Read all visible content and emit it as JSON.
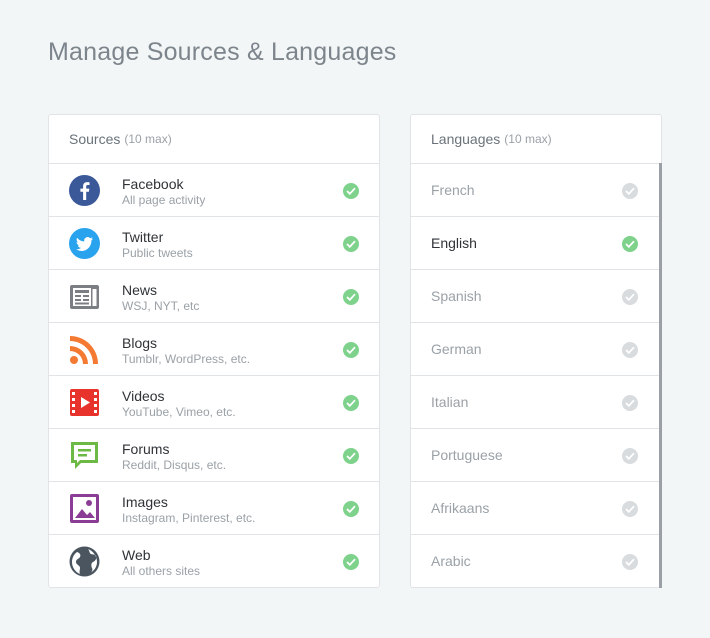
{
  "page": {
    "title": "Manage Sources & Languages"
  },
  "sources": {
    "header": "Sources",
    "max": "(10 max)",
    "items": [
      {
        "name": "Facebook",
        "desc": "All page activity",
        "icon": "facebook-icon",
        "color": "#3b5998",
        "checked": true
      },
      {
        "name": "Twitter",
        "desc": "Public tweets",
        "icon": "twitter-icon",
        "color": "#2aa3ef",
        "checked": true
      },
      {
        "name": "News",
        "desc": "WSJ, NYT, etc",
        "icon": "newspaper-icon",
        "color": "#7b7f83",
        "checked": true
      },
      {
        "name": "Blogs",
        "desc": "Tumblr, WordPress, etc.",
        "icon": "rss-icon",
        "color": "#f47a33",
        "checked": true
      },
      {
        "name": "Videos",
        "desc": "YouTube, Vimeo, etc.",
        "icon": "video-icon",
        "color": "#e8332c",
        "checked": true
      },
      {
        "name": "Forums",
        "desc": "Reddit, Disqus, etc.",
        "icon": "forum-icon",
        "color": "#6db945",
        "checked": true
      },
      {
        "name": "Images",
        "desc": "Instagram, Pinterest, etc.",
        "icon": "image-icon",
        "color": "#8b3d96",
        "checked": true
      },
      {
        "name": "Web",
        "desc": "All others sites",
        "icon": "globe-icon",
        "color": "#4a5560",
        "checked": true
      }
    ]
  },
  "languages": {
    "header": "Languages",
    "max": "(10 max)",
    "items": [
      {
        "name": "French",
        "checked": false
      },
      {
        "name": "English",
        "checked": true
      },
      {
        "name": "Spanish",
        "checked": false
      },
      {
        "name": "German",
        "checked": false
      },
      {
        "name": "Italian",
        "checked": false
      },
      {
        "name": "Portuguese",
        "checked": false
      },
      {
        "name": "Afrikaans",
        "checked": false
      },
      {
        "name": "Arabic",
        "checked": false
      }
    ]
  },
  "colors": {
    "check_on": "#7ed28b",
    "check_off": "#d8dcdf"
  }
}
